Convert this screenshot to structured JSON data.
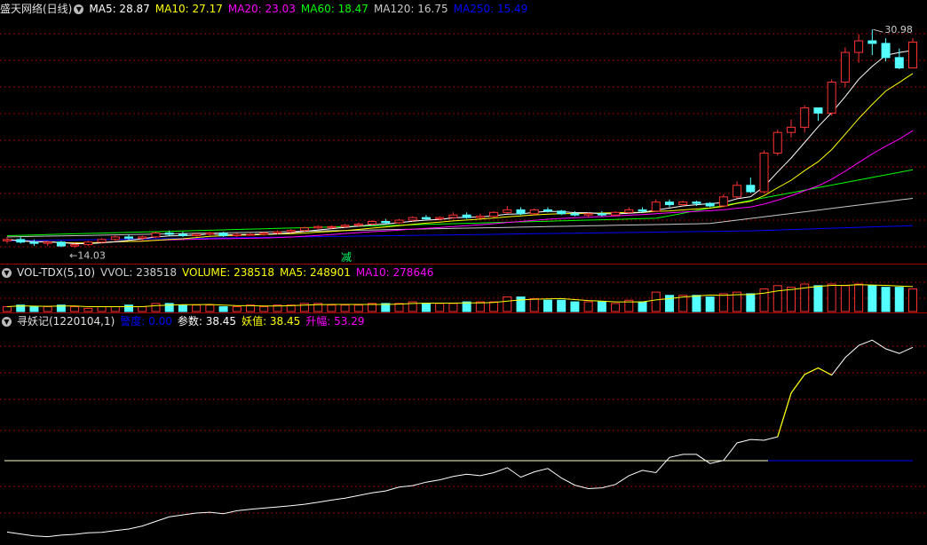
{
  "main": {
    "title": "盛天网络(日线)",
    "indicators": [
      {
        "label": "MA5: 28.87",
        "color": "#ffffff"
      },
      {
        "label": "MA10: 27.17",
        "color": "#ffff00"
      },
      {
        "label": "MA20: 23.03",
        "color": "#ff00ff"
      },
      {
        "label": "MA60: 18.47",
        "color": "#00ff00"
      },
      {
        "label": "MA120: 16.75",
        "color": "#c8c8c8"
      },
      {
        "label": "MA250: 15.49",
        "color": "#0000ff"
      }
    ],
    "high_label": "30.98",
    "low_label": "←14.03",
    "marker_label": "减"
  },
  "vol": {
    "title": "VOL-TDX(5,10)",
    "indicators": [
      {
        "label": "VVOL: 238518",
        "color": "#cccccc"
      },
      {
        "label": "VOLUME: 238518",
        "color": "#ffff00"
      },
      {
        "label": "MA5: 248901",
        "color": "#ffff00"
      },
      {
        "label": "MA10: 278646",
        "color": "#ff00ff"
      }
    ]
  },
  "sub": {
    "title": "寻妖记(1220104,1)",
    "indicators": [
      {
        "label": "警度: 0.00",
        "color": "#0000ff"
      },
      {
        "label": "参数: 38.45",
        "color": "#ffffff"
      },
      {
        "label": "妖值: 38.45",
        "color": "#ffff00"
      },
      {
        "label": "升幅: 53.29",
        "color": "#ff00ff"
      }
    ]
  },
  "colors": {
    "up": "#ff3232",
    "down": "#54ffff",
    "grid": "#a00000",
    "bg": "#000000"
  },
  "chart_data": {
    "type": "candlestick",
    "price_range": [
      14.03,
      30.98
    ],
    "candles": [
      [
        14.6,
        14.9,
        14.4,
        14.7
      ],
      [
        14.7,
        14.9,
        14.4,
        14.5
      ],
      [
        14.5,
        14.7,
        14.2,
        14.4
      ],
      [
        14.4,
        14.6,
        14.2,
        14.5
      ],
      [
        14.5,
        14.6,
        14.1,
        14.2
      ],
      [
        14.2,
        14.4,
        14.03,
        14.3
      ],
      [
        14.3,
        14.6,
        14.2,
        14.5
      ],
      [
        14.5,
        14.8,
        14.4,
        14.7
      ],
      [
        14.7,
        15.0,
        14.6,
        14.9
      ],
      [
        14.9,
        15.1,
        14.7,
        14.8
      ],
      [
        14.8,
        15.0,
        14.6,
        14.9
      ],
      [
        14.9,
        15.3,
        14.8,
        15.2
      ],
      [
        15.2,
        15.4,
        15.0,
        15.1
      ],
      [
        15.1,
        15.3,
        14.9,
        15.0
      ],
      [
        15.0,
        15.2,
        14.9,
        15.1
      ],
      [
        15.1,
        15.3,
        15.0,
        15.2
      ],
      [
        15.2,
        15.3,
        14.9,
        15.0
      ],
      [
        15.0,
        15.2,
        14.9,
        15.1
      ],
      [
        15.1,
        15.2,
        15.0,
        15.1
      ],
      [
        15.1,
        15.3,
        15.0,
        15.2
      ],
      [
        15.2,
        15.4,
        15.1,
        15.3
      ],
      [
        15.3,
        15.5,
        15.2,
        15.4
      ],
      [
        15.4,
        15.7,
        15.3,
        15.6
      ],
      [
        15.6,
        15.8,
        15.5,
        15.7
      ],
      [
        15.7,
        15.8,
        15.5,
        15.7
      ],
      [
        15.7,
        15.9,
        15.6,
        15.8
      ],
      [
        15.8,
        16.0,
        15.7,
        15.9
      ],
      [
        15.9,
        16.2,
        15.8,
        16.1
      ],
      [
        16.1,
        16.3,
        15.9,
        16.0
      ],
      [
        16.0,
        16.3,
        15.9,
        16.2
      ],
      [
        16.2,
        16.5,
        16.1,
        16.4
      ],
      [
        16.4,
        16.6,
        16.2,
        16.3
      ],
      [
        16.3,
        16.5,
        16.2,
        16.4
      ],
      [
        16.4,
        16.8,
        16.3,
        16.6
      ],
      [
        16.6,
        16.8,
        16.3,
        16.4
      ],
      [
        16.4,
        16.7,
        16.3,
        16.5
      ],
      [
        16.5,
        16.9,
        16.4,
        16.8
      ],
      [
        16.8,
        17.3,
        16.7,
        17.0
      ],
      [
        17.0,
        17.2,
        16.6,
        16.7
      ],
      [
        16.7,
        17.1,
        16.6,
        17.0
      ],
      [
        17.0,
        17.2,
        16.8,
        16.9
      ],
      [
        16.9,
        17.0,
        16.6,
        16.7
      ],
      [
        16.7,
        16.9,
        16.5,
        16.6
      ],
      [
        16.6,
        16.8,
        16.4,
        16.7
      ],
      [
        16.7,
        16.9,
        16.5,
        16.6
      ],
      [
        16.6,
        16.9,
        16.5,
        16.8
      ],
      [
        16.8,
        17.2,
        16.7,
        17.0
      ],
      [
        17.0,
        17.2,
        16.8,
        16.9
      ],
      [
        16.9,
        17.8,
        16.9,
        17.6
      ],
      [
        17.6,
        17.8,
        17.2,
        17.4
      ],
      [
        17.4,
        17.7,
        17.3,
        17.6
      ],
      [
        17.6,
        17.7,
        17.3,
        17.5
      ],
      [
        17.5,
        17.6,
        17.2,
        17.3
      ],
      [
        17.3,
        18.2,
        17.2,
        18.0
      ],
      [
        18.0,
        19.2,
        17.9,
        18.9
      ],
      [
        18.9,
        19.5,
        18.3,
        18.4
      ],
      [
        18.4,
        21.6,
        18.3,
        21.4
      ],
      [
        21.4,
        23.2,
        21.2,
        23.0
      ],
      [
        23.0,
        24.0,
        22.6,
        23.4
      ],
      [
        23.4,
        25.1,
        23.0,
        24.9
      ],
      [
        24.9,
        24.8,
        23.9,
        24.5
      ],
      [
        24.5,
        27.1,
        24.3,
        26.9
      ],
      [
        26.9,
        29.6,
        26.5,
        29.2
      ],
      [
        29.2,
        30.6,
        28.4,
        30.1
      ],
      [
        30.1,
        30.98,
        29.0,
        29.9
      ],
      [
        29.9,
        30.3,
        28.5,
        28.8
      ],
      [
        28.8,
        29.5,
        27.9,
        28.0
      ],
      [
        28.0,
        30.3,
        28.0,
        30.0
      ]
    ],
    "volume": [
      3,
      4,
      3,
      3,
      4,
      3,
      2,
      3,
      3,
      4,
      3,
      5,
      5,
      4,
      4,
      4,
      3,
      3,
      4,
      3,
      4,
      4,
      5,
      5,
      4,
      4,
      4,
      5,
      5,
      5,
      6,
      5,
      5,
      5,
      6,
      6,
      6,
      9,
      9,
      8,
      7,
      7,
      6,
      6,
      6,
      5,
      7,
      6,
      12,
      10,
      10,
      10,
      9,
      11,
      12,
      11,
      14,
      16,
      15,
      17,
      16,
      17,
      16,
      17,
      16,
      15,
      15,
      14
    ],
    "sub_series": [
      2,
      1.5,
      1,
      0.8,
      1.2,
      1.4,
      1.8,
      1.9,
      2.4,
      2.8,
      3.6,
      4.8,
      6,
      6.5,
      7,
      7.2,
      6.8,
      7.6,
      8,
      8.3,
      8.6,
      8.9,
      9.3,
      9.8,
      10.4,
      10.9,
      11.6,
      12.3,
      12.8,
      13.8,
      14.2,
      15.1,
      15.7,
      16.6,
      17.2,
      16.8,
      17.6,
      18.9,
      16.4,
      17.8,
      18.7,
      16.2,
      14.3,
      13.4,
      13.6,
      14.5,
      16.8,
      18.2,
      17.6,
      21.6,
      22.4,
      22.4,
      20,
      20.8,
      25.4,
      26.3,
      26.1,
      27,
      38.5,
      43.4,
      45.1,
      43.2,
      47.8,
      51,
      52.4,
      50.1,
      48.9,
      50.5
    ]
  }
}
